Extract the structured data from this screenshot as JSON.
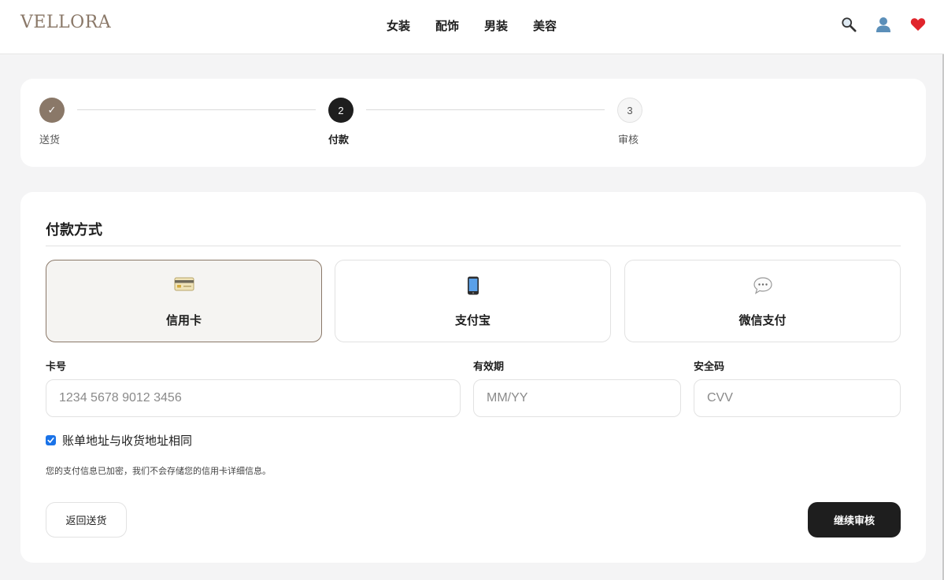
{
  "header": {
    "logo": "VELLORA",
    "nav": [
      "女装",
      "配饰",
      "男装",
      "美容"
    ],
    "icons": [
      "search-icon",
      "user-icon",
      "heart-icon"
    ]
  },
  "steps": [
    {
      "number": "✓",
      "label": "送货",
      "state": "done"
    },
    {
      "number": "2",
      "label": "付款",
      "state": "active"
    },
    {
      "number": "3",
      "label": "审核",
      "state": "todo"
    }
  ],
  "payment": {
    "title": "付款方式",
    "methods": [
      {
        "label": "信用卡",
        "icon": "credit-card-icon",
        "selected": true
      },
      {
        "label": "支付宝",
        "icon": "mobile-phone-icon",
        "selected": false
      },
      {
        "label": "微信支付",
        "icon": "chat-bubble-icon",
        "selected": false
      }
    ],
    "fields": {
      "card_number": {
        "label": "卡号",
        "placeholder": "1234 5678 9012 3456"
      },
      "expiry": {
        "label": "有效期",
        "placeholder": "MM/YY"
      },
      "cvv": {
        "label": "安全码",
        "placeholder": "CVV"
      }
    },
    "same_address": {
      "label": "账单地址与收货地址相同",
      "checked": true
    },
    "note": "您的支付信息已加密，我们不会存储您的信用卡详细信息。",
    "back_label": "返回送货",
    "next_label": "继续审核"
  },
  "colors": {
    "accent": "#8a7868",
    "primary_button": "#1e1e1e",
    "checkbox": "#1a73e8",
    "heart": "#e0242b"
  }
}
